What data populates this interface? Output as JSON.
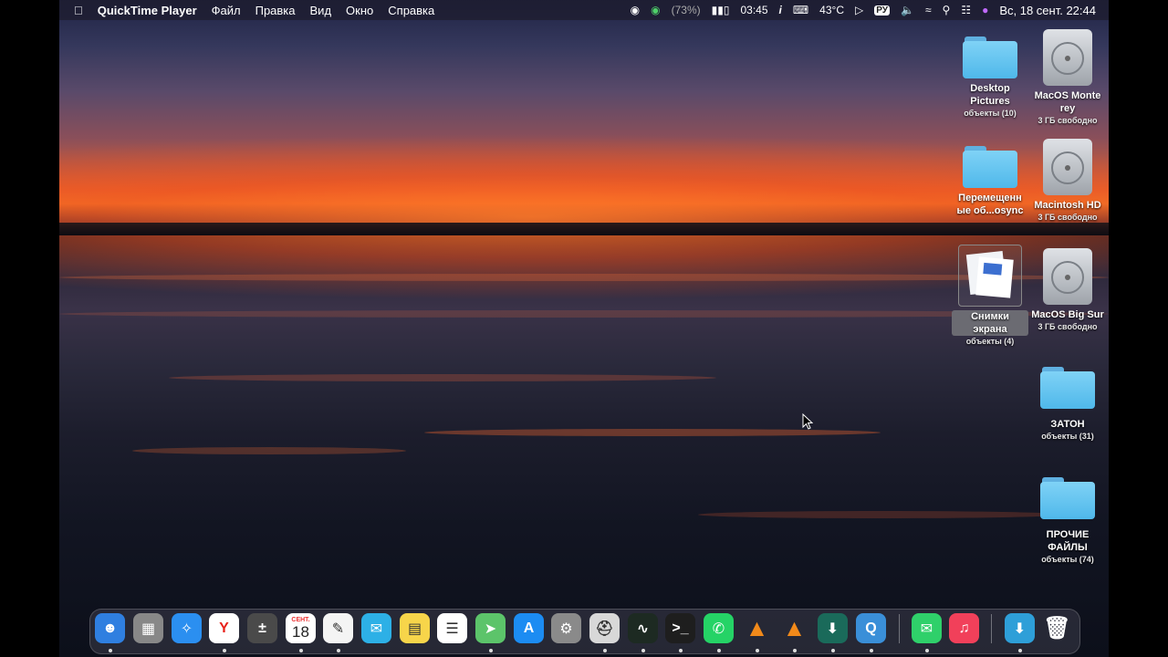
{
  "menubar": {
    "apple_icon": "apple-logo-icon",
    "app_name": "QuickTime Player",
    "menus": [
      "Файл",
      "Правка",
      "Вид",
      "Окно",
      "Справка"
    ],
    "status": {
      "battery_percent_text": "(73%)",
      "time_remaining": "03:45",
      "temperature": "43°C",
      "input_lang": "РУ",
      "datetime": "Вс, 18 сент.  22:44"
    }
  },
  "desktop": {
    "icons": [
      {
        "label": "Desktop Pictures",
        "sub": "объекты (10)",
        "kind": "folder"
      },
      {
        "label": "MacOS Monte rey",
        "sub": "3 ГБ свободно",
        "kind": "disk"
      },
      {
        "label": "Перемещенн ые об...osync",
        "sub": "",
        "kind": "folder"
      },
      {
        "label": "Macintosh HD",
        "sub": "3 ГБ свободно",
        "kind": "disk"
      },
      {
        "label": "Снимки экрана",
        "sub": "объекты (4)",
        "kind": "screenshots"
      },
      {
        "label": "MacOS Big Sur",
        "sub": "3 ГБ свободно",
        "kind": "disk"
      },
      {
        "label": "ЗАТОН",
        "sub": "объекты (31)",
        "kind": "folder"
      },
      {
        "label": "ПРОЧИЕ ФАЙЛЫ",
        "sub": "объекты (74)",
        "kind": "folder"
      }
    ]
  },
  "dock": {
    "calendar_month": "СЕНТ.",
    "calendar_day": "18",
    "apps": [
      {
        "name": "finder-icon",
        "color": "#2f7fe0"
      },
      {
        "name": "launchpad-icon",
        "color": "#888888"
      },
      {
        "name": "safari-icon",
        "color": "#2b8ff0"
      },
      {
        "name": "yandex-browser-icon",
        "color": "#ffffff"
      },
      {
        "name": "calculator-icon",
        "color": "#4a4a4a"
      },
      {
        "name": "calendar-icon",
        "color": "#ffffff"
      },
      {
        "name": "textedit-icon",
        "color": "#f4f4f4"
      },
      {
        "name": "feedback-icon",
        "color": "#2db0e6"
      },
      {
        "name": "notes-icon",
        "color": "#f7d54a"
      },
      {
        "name": "reminders-icon",
        "color": "#ffffff"
      },
      {
        "name": "maps-icon",
        "color": "#5cc46a"
      },
      {
        "name": "app-store-icon",
        "color": "#1c8cf2"
      },
      {
        "name": "system-preferences-icon",
        "color": "#8a8a8a"
      },
      {
        "name": "disk-utility-icon",
        "color": "#d8d8d8"
      },
      {
        "name": "activity-monitor-icon",
        "color": "#1d2a22"
      },
      {
        "name": "terminal-icon",
        "color": "#1e1e1e"
      },
      {
        "name": "whatsapp-icon",
        "color": "#25d366"
      },
      {
        "name": "vlc-icon",
        "color": "#f28a1a"
      },
      {
        "name": "vlc-icon-2",
        "color": "#f28a1a"
      },
      {
        "name": "downloader-icon",
        "color": "#1a6a5a"
      },
      {
        "name": "quicktime-icon",
        "color": "#3a8fd8"
      },
      {
        "name": "messages-icon",
        "color": "#2fd06a"
      },
      {
        "name": "music-icon",
        "color": "#f1405a"
      },
      {
        "name": "downloads-stack-icon",
        "color": "#2e9fd8"
      },
      {
        "name": "trash-icon",
        "color": "#a0a0a8"
      }
    ]
  }
}
